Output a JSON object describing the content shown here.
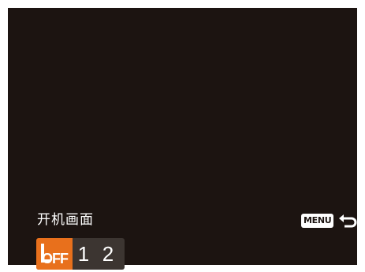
{
  "screen": {
    "title": "开机画面",
    "back": {
      "menu_label": "MENU",
      "icon": "return-arrow-icon"
    },
    "options": [
      {
        "label": "OFF",
        "icon": "off-icon",
        "selected": true
      },
      {
        "label": "1",
        "selected": false
      },
      {
        "label": "2",
        "selected": false
      }
    ]
  },
  "colors": {
    "background": "#1c1411",
    "highlight": "#e8701c",
    "text": "#ffffff"
  }
}
